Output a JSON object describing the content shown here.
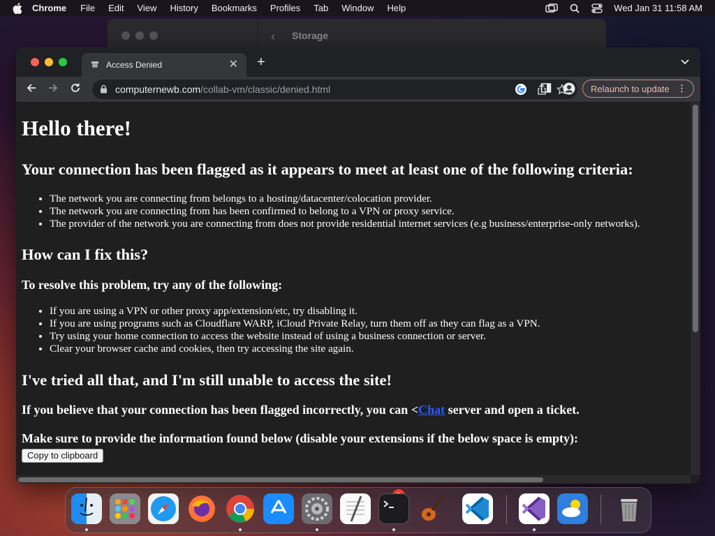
{
  "menubar": {
    "app": "Chrome",
    "items": [
      "File",
      "Edit",
      "View",
      "History",
      "Bookmarks",
      "Profiles",
      "Tab",
      "Window",
      "Help"
    ],
    "clock": "Wed Jan 31  11:58 AM"
  },
  "back_window": {
    "title": "Storage"
  },
  "browser": {
    "tab_title": "Access Denied",
    "url_host": "computernewb.com",
    "url_path": "/collab-vm/classic/denied.html",
    "relaunch_label": "Relaunch to update"
  },
  "page": {
    "h1": "Hello there!",
    "h2_flagged": "Your connection has been flagged as it appears to meet at least one of the following criteria:",
    "criteria": [
      "The network you are connecting from belongs to a hosting/datacenter/colocation provider.",
      "The network you are connecting from has been confirmed to belong to a VPN or proxy service.",
      "The provider of the network you are connecting from does not provide residential internet services (e.g business/enterprise-only networks)."
    ],
    "h2_fix": "How can I fix this?",
    "h3_resolve": "To resolve this problem, try any of the following:",
    "fixes": [
      "If you are using a VPN or other proxy app/extension/etc, try disabling it.",
      "If you are using programs such as Cloudflare WARP, iCloud Private Relay, turn them off as they can flag as a VPN.",
      "Try using your home connection to access the website instead of using a business connection or server.",
      "Clear your browser cache and cookies, then try accessing the site again."
    ],
    "h2_tried": "I've tried all that, and I'm still unable to access the site!",
    "flagged_prefix": "If you believe that your connection has been flagged incorrectly, you can <",
    "flagged_link": "Chat",
    "flagged_suffix": " server and open a ticket.",
    "h3_info": "Make sure to provide the information found below (disable your extensions if the below space is empty):",
    "copy_button": "Copy to clipboard"
  },
  "dock": {
    "apps": [
      "Finder",
      "Launchpad",
      "Safari",
      "Firefox",
      "Chrome",
      "App Store",
      "System Settings",
      "TextEdit",
      "Terminal",
      "GarageBand",
      "Visual Studio Code",
      "Visual Studio",
      "Weather",
      "Trash"
    ],
    "settings_badge": "1"
  },
  "colors": {
    "traffic_red": "#ff5f57",
    "traffic_yellow": "#febc2e",
    "traffic_green": "#28c840",
    "relaunch_accent": "#f1b8b0",
    "link": "#2a5bff"
  }
}
